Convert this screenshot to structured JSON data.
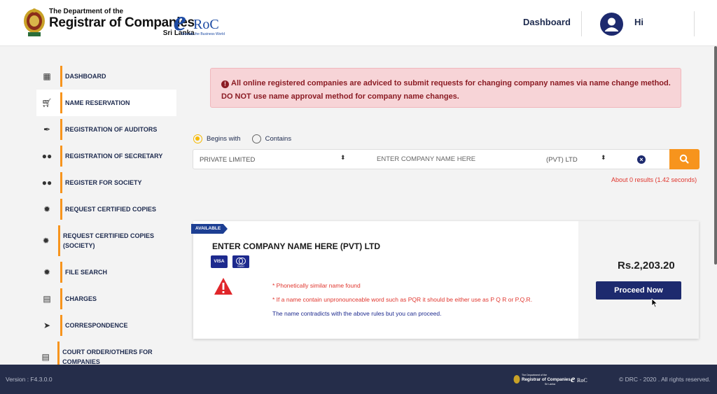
{
  "header": {
    "dept_line": "The Department of the",
    "registrar": "Registrar of Companies",
    "country": "Sri Lanka",
    "eroc_e": "e",
    "eroc_text": "RoC",
    "eroc_tagline": "Towards the Business World",
    "dashboard_link": "Dashboard",
    "greeting": "Hi"
  },
  "sidebar": {
    "items": [
      {
        "label": "DASHBOARD",
        "icon": "building-icon"
      },
      {
        "label": "NAME RESERVATION",
        "icon": "cart-icon",
        "active": true
      },
      {
        "label": "REGISTRATION OF AUDITORS",
        "icon": "pen-icon"
      },
      {
        "label": "REGISTRATION OF SECRETARY",
        "icon": "users-icon"
      },
      {
        "label": "REGISTER FOR SOCIETY",
        "icon": "users-icon"
      },
      {
        "label": "REQUEST CERTIFIED COPIES",
        "icon": "seal-icon"
      },
      {
        "label": "REQUEST CERTIFIED COPIES (SOCIETY)",
        "icon": "seal-icon"
      },
      {
        "label": "FILE SEARCH",
        "icon": "seal-icon"
      },
      {
        "label": "CHARGES",
        "icon": "file-invoice-icon"
      },
      {
        "label": "CORRESPONDENCE",
        "icon": "paper-plane-icon"
      },
      {
        "label": "COURT ORDER/OTHERS FOR COMPANIES",
        "icon": "file-plus-icon"
      }
    ]
  },
  "alert": {
    "line1": "All online registered companies are adviced to submit requests for changing company names via name change method.",
    "line2": "DO NOT use name approval method for company name changes."
  },
  "search": {
    "option_begins": "Begins with",
    "option_contains": "Contains",
    "selected_option": "Begins with",
    "company_type": "PRIVATE LIMITED",
    "name_placeholder": "ENTER COMPANY NAME HERE",
    "suffix": "(PVT) LTD",
    "results_text": "About 0 results (1.42 seconds)"
  },
  "result_card": {
    "badge": "AVAILABLE",
    "title": "ENTER COMPANY NAME HERE (PVT) LTD",
    "pay_visa": "VISA",
    "pay_master": "master",
    "messages": [
      {
        "text": "* Phonetically similar name found",
        "color": "red"
      },
      {
        "text": "* If a name contain unpronounceable word such as PQR it should be either use as P Q R or P.Q.R.",
        "color": "red"
      },
      {
        "text": "The name contradicts with the above rules but you can proceed.",
        "color": "blue"
      }
    ],
    "price": "Rs.2,203.20",
    "proceed_label": "Proceed Now"
  },
  "footer": {
    "version": "Version : F4.3.0.0",
    "copyright": "© DRC - 2020 . All rights reserved."
  },
  "colors": {
    "accent_orange": "#f7941d",
    "navy": "#1d2a6e",
    "alert_bg": "#f7d4d7",
    "error_red": "#e0362e",
    "footer_bg": "#252d4a"
  }
}
